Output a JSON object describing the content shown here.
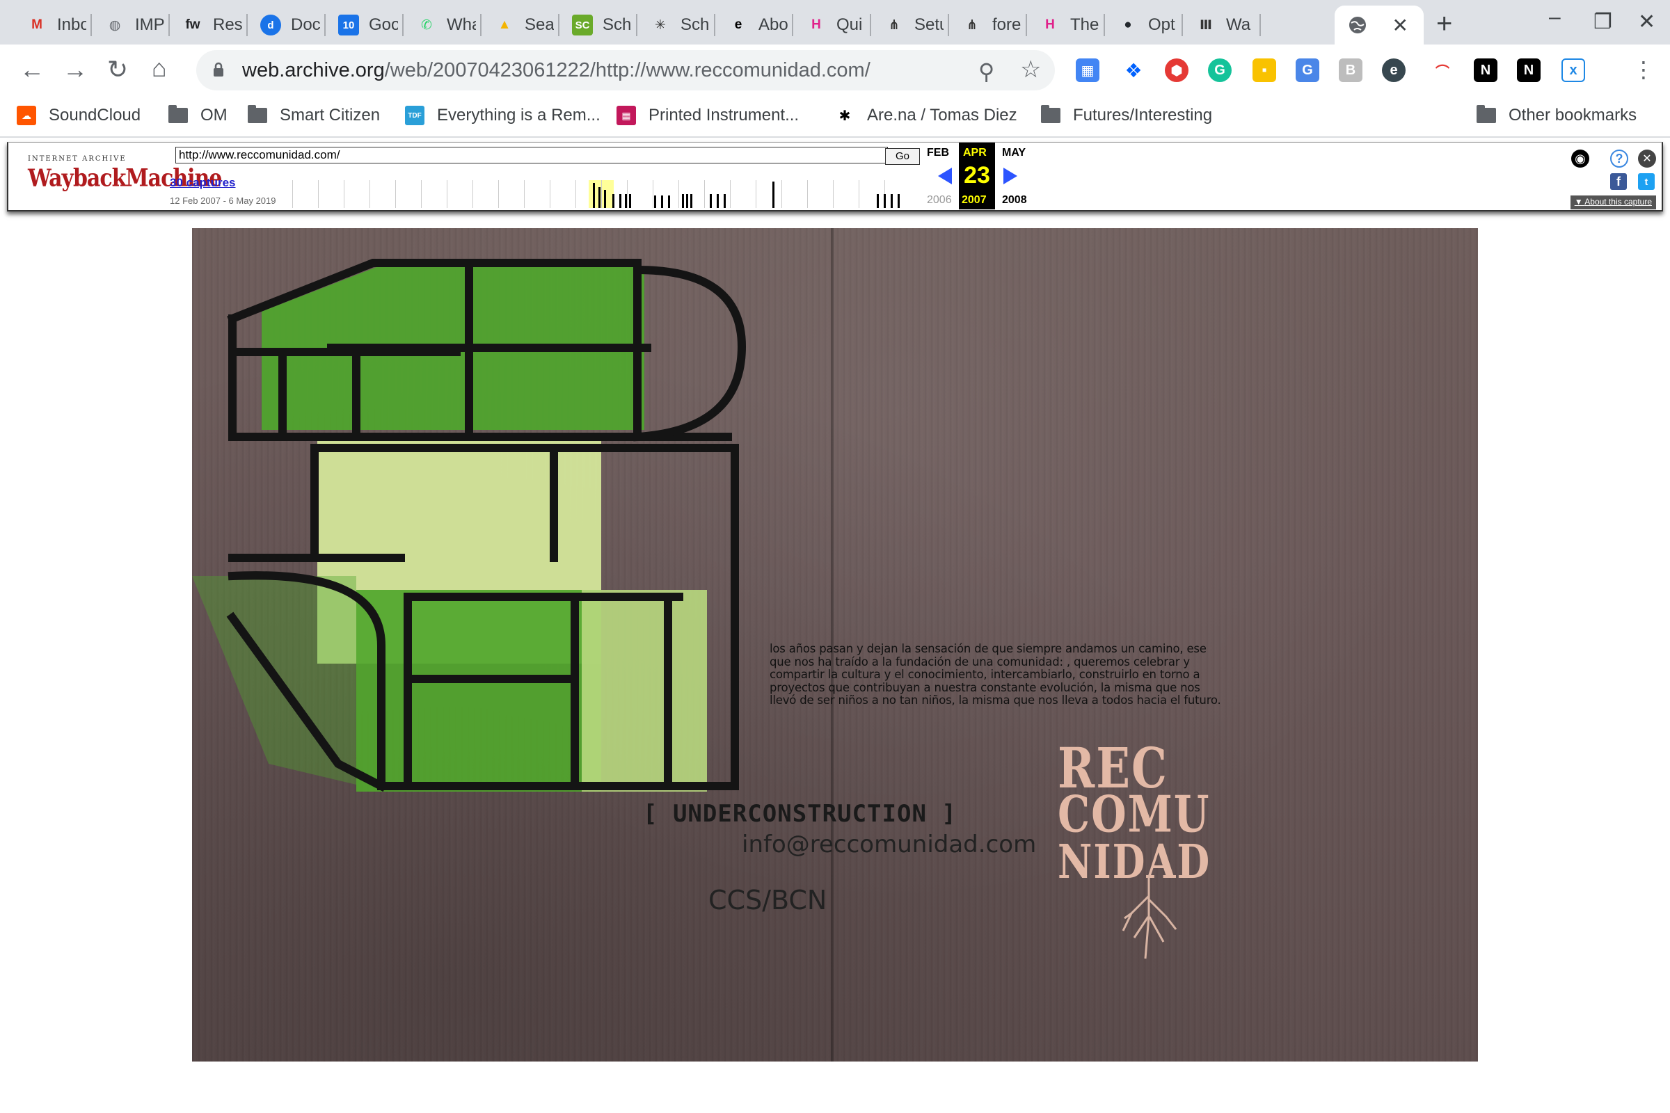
{
  "tabs": [
    {
      "title": "Inbox",
      "icon": "gmail-icon",
      "fav": "M",
      "color": "#d93025"
    },
    {
      "title": "IMP",
      "icon": "globe-icon",
      "fav": "◍",
      "color": "#5f6368"
    },
    {
      "title": "Res",
      "icon": "fw-icon",
      "fav": "fw",
      "color": "#202124"
    },
    {
      "title": "Doc",
      "icon": "d-icon",
      "fav": "d",
      "color": "#1a73e8"
    },
    {
      "title": "Goo",
      "icon": "calendar-icon",
      "fav": "10",
      "color": "#1a73e8"
    },
    {
      "title": "Wha",
      "icon": "whatsapp-icon",
      "fav": "✆",
      "color": "#25d366"
    },
    {
      "title": "Sea",
      "icon": "drive-icon",
      "fav": "▲",
      "color": "#f4b400"
    },
    {
      "title": "Sch",
      "icon": "sc-icon",
      "fav": "SC",
      "color": "#6aaa2a"
    },
    {
      "title": "Sch",
      "icon": "asterisk-icon",
      "fav": "✳",
      "color": "#333333"
    },
    {
      "title": "Abo",
      "icon": "e-icon",
      "fav": "e",
      "color": "#000000"
    },
    {
      "title": "Qui",
      "icon": "hexagon-h-icon",
      "fav": "H",
      "color": "#e0218a"
    },
    {
      "title": "Setu",
      "icon": "fork-icon",
      "fav": "⋔",
      "color": "#333333"
    },
    {
      "title": "fore",
      "icon": "fork-icon",
      "fav": "⋔",
      "color": "#333333"
    },
    {
      "title": "The",
      "icon": "hexagon-h-icon",
      "fav": "H",
      "color": "#e0218a"
    },
    {
      "title": "Opt",
      "icon": "github-icon",
      "fav": "●",
      "color": "#24292e"
    },
    {
      "title": "Wa",
      "icon": "archive-icon",
      "fav": "Ⅲ",
      "color": "#333333"
    }
  ],
  "active_tab": {
    "icon": "globe-icon",
    "close": "✕"
  },
  "url": {
    "host": "web.archive.org",
    "path": "/web/20070423061222/http://www.reccomunidad.com/"
  },
  "bookmarks": [
    {
      "label": "SoundCloud",
      "type": "site",
      "icon": "soundcloud-icon",
      "color": "#ff5500"
    },
    {
      "label": "OM",
      "type": "folder"
    },
    {
      "label": "Smart Citizen",
      "type": "folder"
    },
    {
      "label": "Everything is a Rem...",
      "type": "site",
      "icon": "tdf-icon",
      "color": "#2a9fd8"
    },
    {
      "label": "Printed Instrument...",
      "type": "site",
      "icon": "printed-icon",
      "color": "#c2185b"
    },
    {
      "label": "Are.na / Tomas Diez",
      "type": "site",
      "icon": "arena-icon",
      "color": "#000000"
    },
    {
      "label": "Futures/Interesting",
      "type": "folder"
    }
  ],
  "other_bookmarks": "Other bookmarks",
  "wayback": {
    "logo_top": "INTERNET ARCHIVE",
    "logo": "WaybackMachine",
    "url_value": "http://www.reccomunidad.com/",
    "go": "Go",
    "captures": "30 captures",
    "range": "12 Feb 2007 - 6 May 2019",
    "prev_month": "FEB",
    "cur_month": "APR",
    "next_month": "MAY",
    "cur_day": "23",
    "prev_year": "2006",
    "cur_year": "2007",
    "next_year": "2008",
    "about": "About this capture"
  },
  "artwork": {
    "paragraph": "los años pasan y dejan la sensación de que siempre andamos un camino, ese que nos ha traído a la fundación de una comunidad: , queremos celebrar y compartir la cultura y el conocimiento, intercambiarlo, construirlo en torno a proyectos que contribuyan a nuestra constante evolución, la misma que nos llevó de ser niños a no tan niños, la misma que nos lleva a todos hacia el futuro.",
    "underconstruction": "[ UNDERCONSTRUCTION ]",
    "email": "info@reccomunidad.com",
    "location": "CCS/BCN",
    "logo_lines": [
      "REC",
      "COMU",
      "NIDAD"
    ]
  }
}
